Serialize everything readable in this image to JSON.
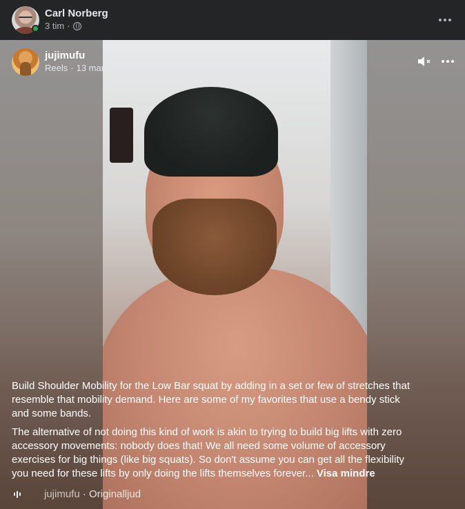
{
  "post": {
    "author": "Carl Norberg",
    "time": "3 tim",
    "separator": "·",
    "privacy_icon": "globe-icon",
    "more_icon": "more-horizontal-icon"
  },
  "reel": {
    "account": "jujimufu",
    "source": "Reels",
    "date": "13 mar",
    "separator": "·",
    "platform_icon": "instagram-icon",
    "mute_icon": "speaker-muted-icon",
    "more_icon": "more-horizontal-icon"
  },
  "caption": {
    "paragraph1": "Build Shoulder Mobility for the Low Bar squat by adding in a set or few of stretches that resemble that mobility demand. Here are some of my favorites that use a bendy stick and some bands.",
    "paragraph2": "The alternative of not doing this kind of work is akin to trying to build big lifts with zero accessory movements: nobody does that! We all need some volume of accessory exercises for big things (like big squats). So don't assume you can get all the flexibility you need for these lifts by only doing the lifts themselves forever...",
    "see_less": "Visa mindre"
  },
  "audio": {
    "icon": "audio-wave-icon",
    "user": "jujimufu",
    "separator": "·",
    "track": "Originalljud"
  },
  "colors": {
    "background": "#242526",
    "online": "#31a24c",
    "text_primary": "#e4e6eb",
    "text_secondary": "#b0b3b8"
  }
}
